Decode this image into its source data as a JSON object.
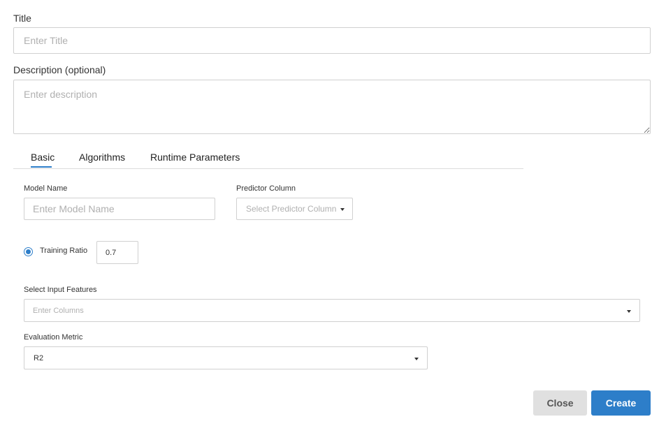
{
  "form": {
    "title_label": "Title",
    "title_placeholder": "Enter Title",
    "description_label": "Description (optional)",
    "description_placeholder": "Enter description"
  },
  "tabs": [
    {
      "label": "Basic",
      "active": true
    },
    {
      "label": "Algorithms",
      "active": false
    },
    {
      "label": "Runtime Parameters",
      "active": false
    }
  ],
  "basic": {
    "model_name_label": "Model Name",
    "model_name_placeholder": "Enter Model Name",
    "predictor_column_label": "Predictor Column",
    "predictor_column_placeholder": "Select Predictor Column",
    "training_ratio_label": "Training Ratio",
    "training_ratio_value": "0.7",
    "input_features_label": "Select Input Features",
    "input_features_placeholder": "Enter Columns",
    "evaluation_metric_label": "Evaluation Metric",
    "evaluation_metric_value": "R2"
  },
  "footer": {
    "close_label": "Close",
    "create_label": "Create"
  },
  "colors": {
    "accent": "#2d7ec9",
    "close_bg": "#e0e0e0",
    "border": "#d0d0d0"
  }
}
